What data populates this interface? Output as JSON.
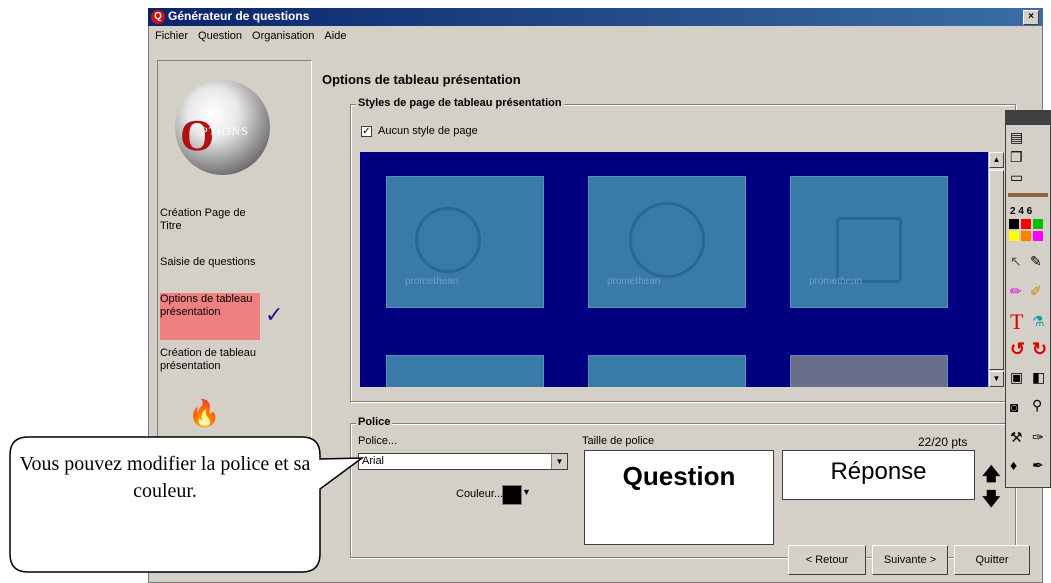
{
  "window": {
    "title": "Générateur de questions",
    "close_label": "×"
  },
  "menu": {
    "items": [
      "Fichier",
      "Question",
      "Organisation",
      "Aide"
    ]
  },
  "logo": {
    "text": "PTIONS"
  },
  "steps": [
    {
      "label": "Création Page de Titre",
      "active": false
    },
    {
      "label": "Saisie de questions",
      "active": false
    },
    {
      "label": "Options de tableau présentation",
      "active": true
    },
    {
      "label": "Création de tableau présentation",
      "active": false
    }
  ],
  "main": {
    "heading": "Options de tableau présentation",
    "styles_group": {
      "title": "Styles de page de tableau présentation",
      "checkbox_label": "Aucun style de page",
      "checked": true,
      "tile_watermark": "promethean"
    },
    "font_group": {
      "title": "Police",
      "police_label": "Police...",
      "police_value": "Arial",
      "size_label": "Taille de police",
      "size_value": "22/20 pts",
      "color_label": "Couleur...",
      "question_preview": "Question",
      "answer_preview": "Réponse"
    }
  },
  "buttons": {
    "back": "< Retour",
    "next": "Suivante >",
    "quit": "Quitter"
  },
  "toolbox": {
    "numbers": "2 4 6",
    "swatches": [
      "#000000",
      "#ff0000",
      "#00c000",
      "#ffff00",
      "#ff8000",
      "#ff00ff"
    ]
  },
  "callout": {
    "text": "Vous pouvez modifier la police et sa couleur."
  },
  "colors": {
    "title_bar": "#0a246a",
    "active_step": "#f08080",
    "preview_bg": "#000080",
    "tile": "#3a7aa8"
  }
}
